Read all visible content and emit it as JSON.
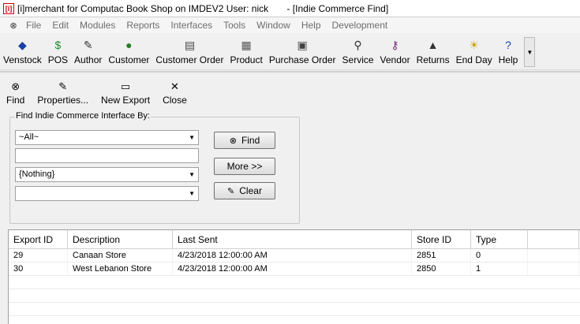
{
  "window": {
    "icon_text": "[i]",
    "title": "[i]merchant for Computac Book Shop on IMDEV2 User: nick       - [Indie Commerce Find]"
  },
  "menubar": {
    "items": [
      "File",
      "Edit",
      "Modules",
      "Reports",
      "Interfaces",
      "Tools",
      "Window",
      "Help",
      "Development"
    ]
  },
  "toolbar": {
    "buttons": [
      {
        "label": "Venstock",
        "icon": "diamond-icon",
        "glyph": "◆",
        "color": "#1a3fa8"
      },
      {
        "label": "POS",
        "icon": "dollar-icon",
        "glyph": "$",
        "color": "#1a8a2a"
      },
      {
        "label": "Author",
        "icon": "author-icon",
        "glyph": "✎",
        "color": "#333333"
      },
      {
        "label": "Customer",
        "icon": "globe-icon",
        "glyph": "●",
        "color": "#2a7a2a"
      },
      {
        "label": "Customer Order",
        "icon": "order-icon",
        "glyph": "▤",
        "color": "#444444"
      },
      {
        "label": "Product",
        "icon": "book-icon",
        "glyph": "▦",
        "color": "#555555"
      },
      {
        "label": "Purchase Order",
        "icon": "po-icon",
        "glyph": "▣",
        "color": "#444444"
      },
      {
        "label": "Service",
        "icon": "wrench-icon",
        "glyph": "⚲",
        "color": "#333333"
      },
      {
        "label": "Vendor",
        "icon": "vendor-icon",
        "glyph": "⚷",
        "color": "#7a2a7a"
      },
      {
        "label": "Returns",
        "icon": "returns-icon",
        "glyph": "▲",
        "color": "#333333"
      },
      {
        "label": "End Day",
        "icon": "sun-icon",
        "glyph": "☀",
        "color": "#c9a400"
      },
      {
        "label": "Help",
        "icon": "help-icon",
        "glyph": "?",
        "color": "#1a3fa8"
      }
    ],
    "overflow_icon": "chevron-down-icon"
  },
  "subtoolbar": {
    "buttons": [
      {
        "label": "Find",
        "icon": "binoculars-icon",
        "glyph": "⊗"
      },
      {
        "label": "Properties...",
        "icon": "properties-icon",
        "glyph": "✎"
      },
      {
        "label": "New Export",
        "icon": "new-document-icon",
        "glyph": "▭"
      },
      {
        "label": "Close",
        "icon": "close-icon",
        "glyph": "✕"
      }
    ]
  },
  "find_panel": {
    "title": "Find Indie Commerce Interface By:",
    "combo1_value": "~All~",
    "textbox_value": "",
    "combo2_value": "{Nothing}",
    "combo3_value": "",
    "find_label": "Find",
    "more_label": "More >>",
    "clear_label": "Clear"
  },
  "grid": {
    "columns": [
      "Export ID",
      "Description",
      "Last Sent",
      "Store ID",
      "Type",
      ""
    ],
    "rows": [
      [
        "29",
        "Canaan Store",
        "4/23/2018 12:00:00 AM",
        "2851",
        "0",
        ""
      ],
      [
        "30",
        "West Lebanon Store",
        "4/23/2018 12:00:00 AM",
        "2850",
        "1",
        ""
      ]
    ]
  }
}
